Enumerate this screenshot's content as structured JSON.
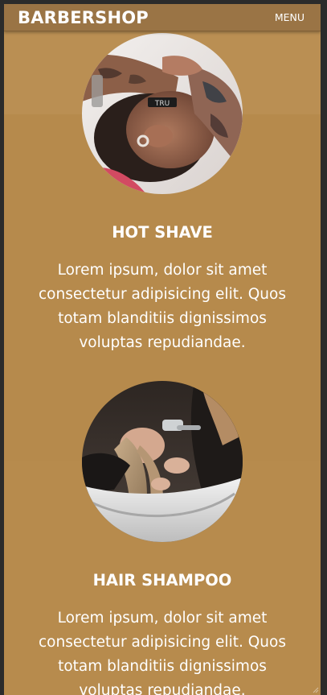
{
  "navbar": {
    "brand": "BARBERSHOP",
    "menu_label": "MENU"
  },
  "services": [
    {
      "title": "HOT SHAVE",
      "description": "Lorem ipsum, dolor sit amet consectetur adipisicing elit. Quos totam blanditiis dignissimos voluptas repudiandae.",
      "image_icon": "barber-shave-photo",
      "razor_text": "TRU"
    },
    {
      "title": "HAIR SHAMPOO",
      "description": "Lorem ipsum, dolor sit amet consectetur adipisicing elit. Quos totam blanditiis dignissimos voluptas repudiandae.",
      "image_icon": "hair-wash-photo"
    }
  ],
  "colors": {
    "page_background": "#b68a4c",
    "navbar_background": "#9a7445",
    "text": "#ffffff",
    "outer_background": "#2b2b2b"
  }
}
